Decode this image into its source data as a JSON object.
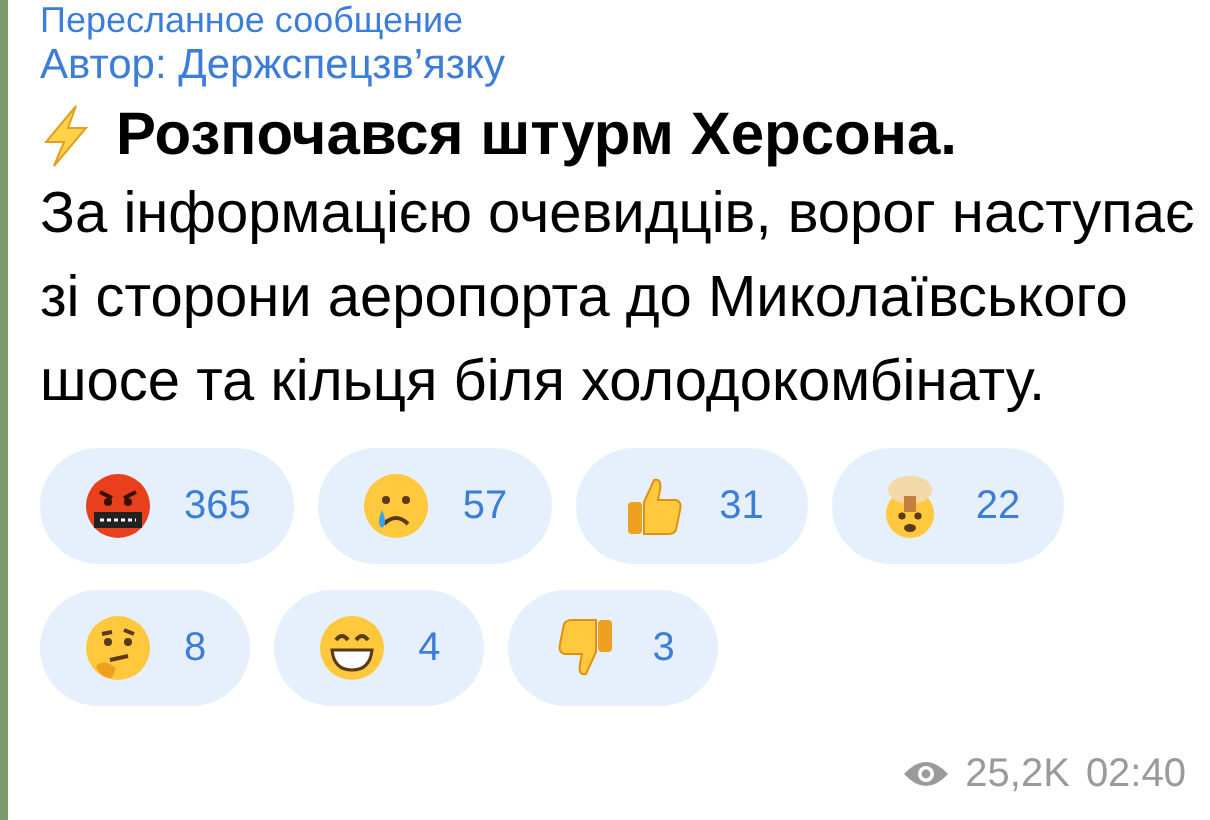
{
  "forwarded": {
    "label": "Пересланное сообщение",
    "author": "Автор: Держспецзв’язку"
  },
  "message": {
    "title": "Розпочався штурм Херсона.",
    "body": "За інформацією очевидців, ворог наступає зі сторони аеропорта до Миколаївського шосе та кільця біля холодокомбінату."
  },
  "reactions": [
    {
      "kind": "angry",
      "count": "365"
    },
    {
      "kind": "crying",
      "count": "57"
    },
    {
      "kind": "thumbs_up",
      "count": "31"
    },
    {
      "kind": "exploding",
      "count": "22"
    },
    {
      "kind": "thinking",
      "count": "8"
    },
    {
      "kind": "grin",
      "count": "4"
    },
    {
      "kind": "thumbs_down",
      "count": "3"
    }
  ],
  "footer": {
    "views": "25,2K",
    "time": "02:40"
  }
}
